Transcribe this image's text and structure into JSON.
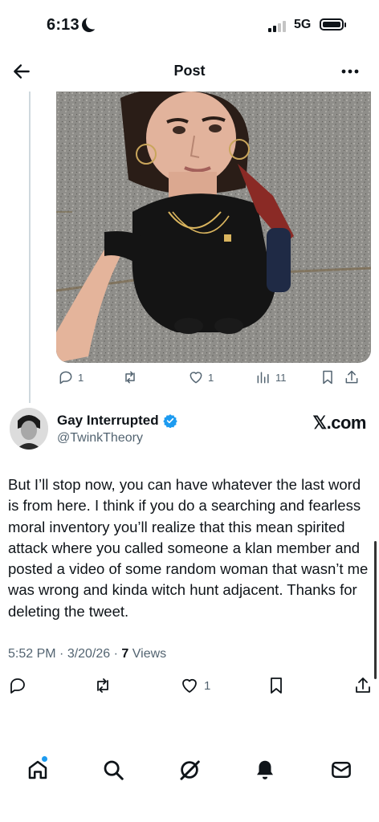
{
  "status_bar": {
    "time": "6:13",
    "network": "5G",
    "icons": [
      "moon-icon",
      "signal-icon",
      "battery-icon"
    ]
  },
  "header": {
    "title": "Post",
    "back_icon": "arrow-left-icon",
    "more_icon": "more-dots-icon"
  },
  "parent_post": {
    "image_description_icon": "photo",
    "actions": {
      "replies": "1",
      "reposts": "",
      "likes": "1",
      "views": "11"
    }
  },
  "post": {
    "author_name": "Gay Interrupted",
    "author_handle": "@TwinkTheory",
    "verified": true,
    "brand": "𝕏.com",
    "text": "But I’ll stop now, you can have whatever the last word is from here. I think if you do a searching and fearless moral inventory you’ll realize that this mean spirited attack where you called someone a klan member and posted a video of some random woman that wasn’t me was wrong and kinda witch hunt adjacent. Thanks for deleting the tweet.",
    "time": "5:52 PM",
    "date": "3/20/26",
    "views_count": "7",
    "views_label": "Views",
    "actions": {
      "replies": "",
      "reposts": "",
      "likes": "1"
    }
  },
  "bottom_nav": {
    "items": [
      "home-icon",
      "search-icon",
      "grok-icon",
      "notifications-icon",
      "messages-icon"
    ],
    "accent": "#1d9bf0"
  },
  "colors": {
    "text": "#0f1419",
    "secondary": "#536471",
    "verified": "#1d9bf0",
    "divider": "#cfd9de"
  }
}
